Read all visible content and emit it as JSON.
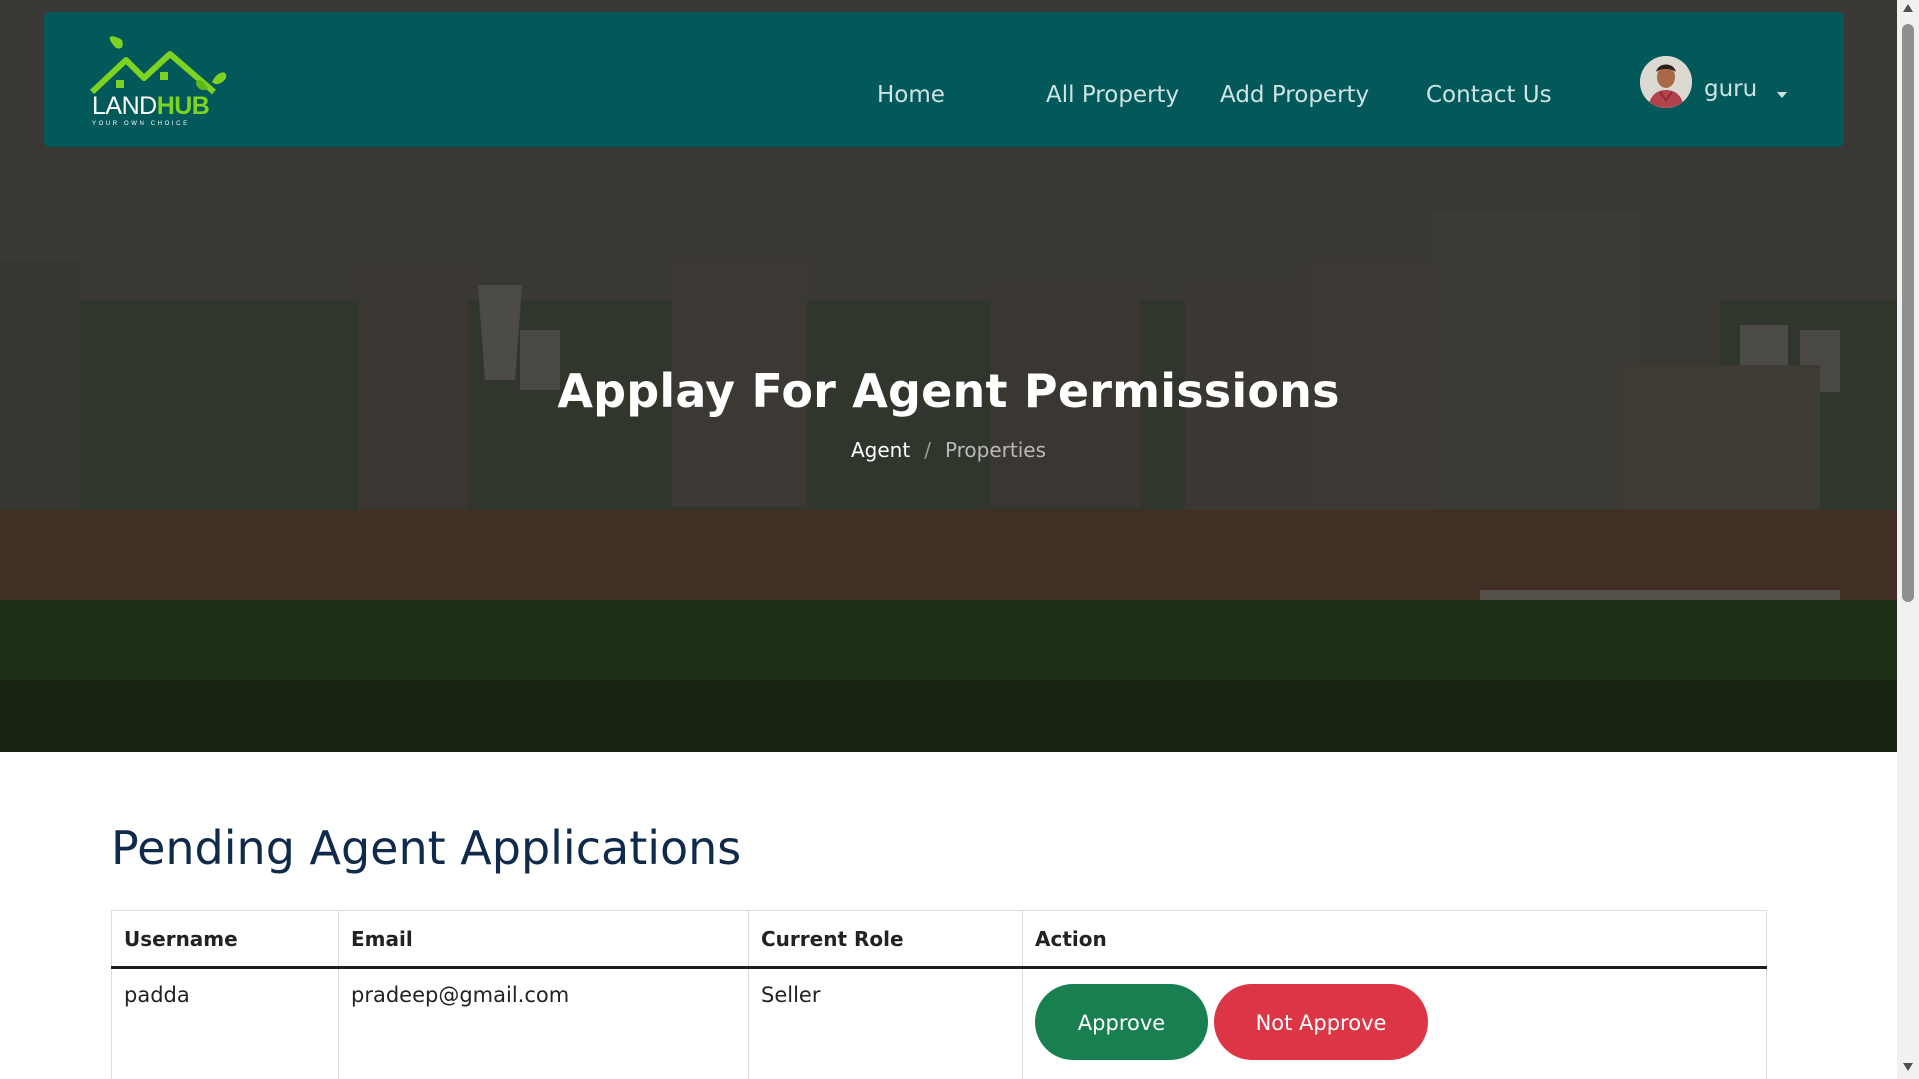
{
  "navbar": {
    "logo": {
      "word_land": "LAND",
      "word_hub": "HUB",
      "tagline": "YOUR OWN CHOICE"
    },
    "links": [
      {
        "label": "Home"
      },
      {
        "label": "All Property"
      },
      {
        "label": "Add Property"
      },
      {
        "label": "Contact Us"
      }
    ],
    "user": {
      "name": "guru",
      "icon": "chevron-down-icon"
    }
  },
  "hero": {
    "title": "Applay For Agent Permissions",
    "breadcrumb": {
      "active": "Agent",
      "separator": "/",
      "current": "Properties"
    }
  },
  "main": {
    "heading": "Pending Agent Applications",
    "table": {
      "columns": [
        "Username",
        "Email",
        "Current Role",
        "Action"
      ],
      "rows": [
        {
          "username": "padda",
          "email": "pradeep@gmail.com",
          "role": "Seller",
          "approve_label": "Approve",
          "reject_label": "Not Approve"
        }
      ]
    }
  },
  "colors": {
    "navbar": "#03595a",
    "approve": "#188050",
    "reject": "#dc3545",
    "heading": "#0f2a4a",
    "logo_accent": "#7ed321"
  }
}
